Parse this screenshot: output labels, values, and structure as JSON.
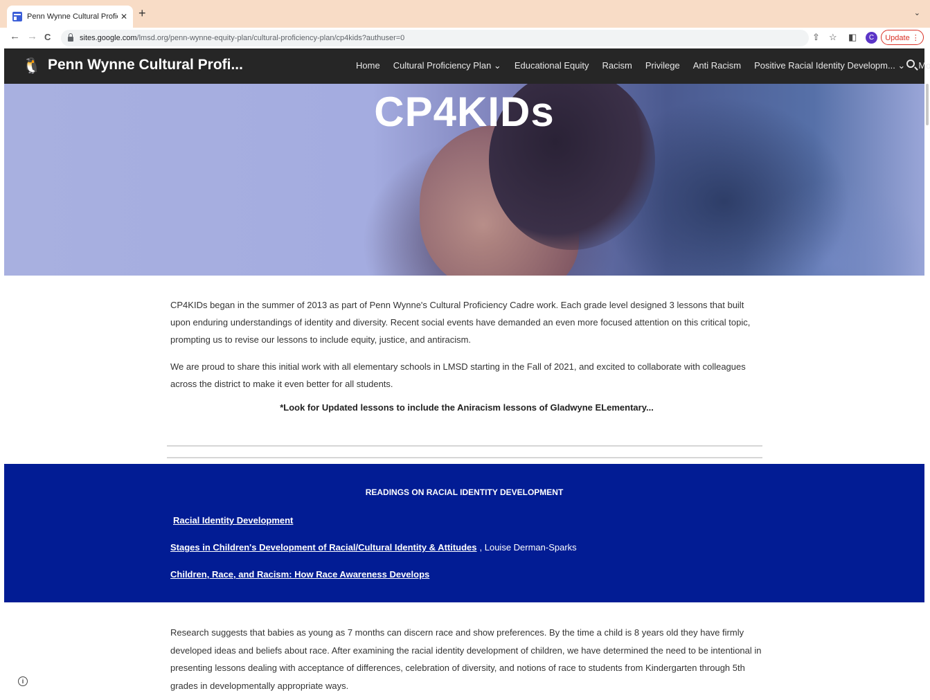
{
  "browser": {
    "tab_title": "Penn Wynne Cultural Proficien",
    "tab_close": "✕",
    "new_tab": "+",
    "tab_dropdown": "⌄",
    "back": "←",
    "forward": "→",
    "reload": "C",
    "url_host": "sites.google.com",
    "url_path": "/lmsd.org/penn-wynne-equity-plan/cultural-proficiency-plan/cp4kids?authuser=0",
    "share_icon": "⇧",
    "star_icon": "☆",
    "sidepanel_icon": "◧",
    "profile_initial": "C",
    "update_label": "Update  ⋮"
  },
  "site": {
    "logo_icon": "penguin-icon",
    "title": "Penn Wynne Cultural Profi...",
    "nav": [
      {
        "label": "Home"
      },
      {
        "label": "Cultural Proficiency Plan ⌄"
      },
      {
        "label": "Educational Equity"
      },
      {
        "label": "Racism"
      },
      {
        "label": "Privilege"
      },
      {
        "label": "Anti Racism"
      },
      {
        "label": "Positive Racial Identity Developm... ⌄"
      },
      {
        "label": "More ⌄"
      }
    ]
  },
  "banner": {
    "title": "CP4KIDs"
  },
  "intro": {
    "para1": "CP4KIDs began in the summer of 2013 as part of Penn Wynne's Cultural Proficiency Cadre work. Each grade level designed 3 lessons that built upon enduring understandings of identity and diversity. Recent social events have demanded an even more focused attention on this critical topic, prompting us to revise our lessons to include equity, justice, and antiracism.",
    "para2": "We are proud  to share this initial work with all elementary schools in LMSD starting in the Fall of 2021, and excited to collaborate with colleagues across the district to make it even better for all students.",
    "note": "*Look for Updated lessons to include the Aniracism lessons of Gladwyne ELementary..."
  },
  "readings": {
    "title": "READINGS ON RACIAL IDENTITY DEVELOPMENT",
    "links": [
      {
        "label": "Racial Identity Development ",
        "author": ""
      },
      {
        "label": "Stages in Children's Development of Racial/Cultural Identity & Attitudes",
        "author": ", Louise Derman-Sparks"
      },
      {
        "label": "Children, Race, and Racism: How Race Awareness Develops",
        "author": ""
      }
    ]
  },
  "research": {
    "text": " Research suggests that babies as young as 7 months can discern race and show preferences. By the time a child is 8 years old they have firmly developed ideas and beliefs about race. After examining the racial identity development of children, we have determined the need to be intentional in presenting lessons dealing with acceptance of differences, celebration of diversity,  and notions of race  to students from Kindergarten through 5th grades in developmentally appropriate ways."
  },
  "footer": {
    "info_glyph": "i"
  }
}
